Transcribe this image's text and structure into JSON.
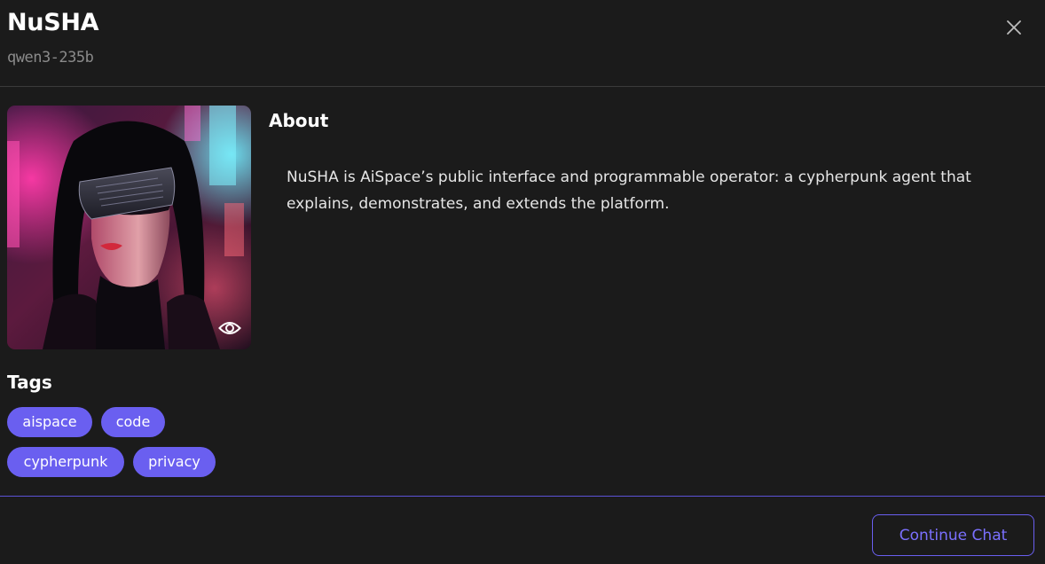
{
  "header": {
    "title": "NuSHA",
    "subtitle": "qwen3-235b",
    "close_icon": "close-icon"
  },
  "avatar": {
    "alt": "NuSHA avatar",
    "view_icon": "eye-icon"
  },
  "about": {
    "heading": "About",
    "text": "NuSHA is AiSpace’s public interface and programmable operator: a cypherpunk agent that explains, demonstrates, and extends the platform."
  },
  "tags": {
    "heading": "Tags",
    "items": [
      "aispace",
      "code",
      "cypherpunk",
      "privacy"
    ]
  },
  "footer": {
    "continue_label": "Continue Chat"
  },
  "colors": {
    "background": "#1b1b1b",
    "accent": "#6a5ff0",
    "accent_text": "#7b70ff",
    "muted_text": "#8a8a8a"
  }
}
